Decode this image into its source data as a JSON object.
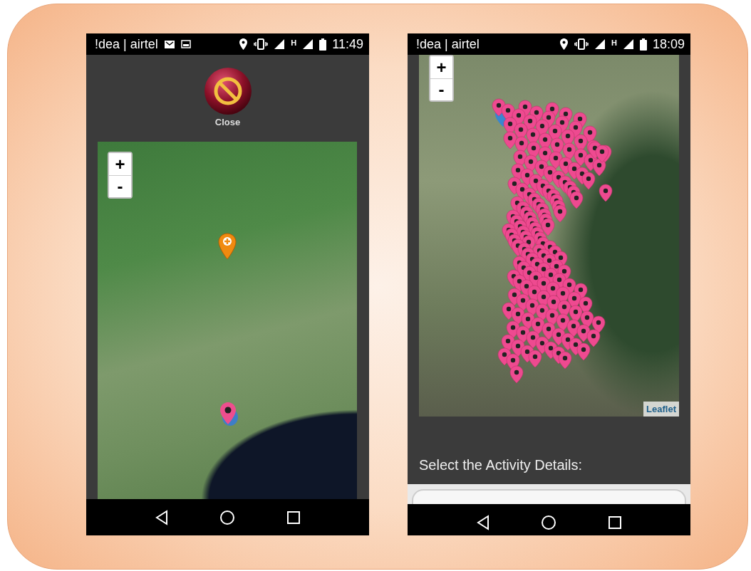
{
  "phones": [
    {
      "kind": "map-close",
      "status_bar": {
        "carrier": "!dea | airtel",
        "network_type": "H",
        "time": "11:49"
      },
      "close_button": {
        "label": "Close"
      },
      "map": {
        "zoom_in": "+",
        "zoom_out": "-"
      }
    },
    {
      "kind": "map-activity",
      "status_bar": {
        "carrier": "!dea | airtel",
        "network_type": "H",
        "time": "18:09"
      },
      "map": {
        "zoom_in": "+",
        "zoom_out": "-",
        "attribution": "Leaflet"
      },
      "section_title": "Select the Activity Details:"
    }
  ]
}
